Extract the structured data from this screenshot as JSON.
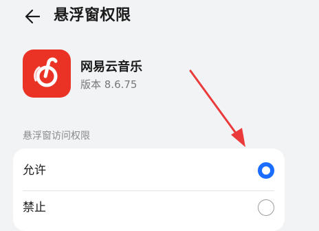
{
  "header": {
    "title": "悬浮窗权限",
    "back_icon": "arrow-left-icon"
  },
  "app": {
    "name": "网易云音乐",
    "version": "版本 8.6.75",
    "icon": "netease-cloud-music-icon",
    "icon_color": "#ea3324"
  },
  "section": {
    "label": "悬浮窗访问权限"
  },
  "options": [
    {
      "label": "允许",
      "selected": true
    },
    {
      "label": "禁止",
      "selected": false
    }
  ],
  "colors": {
    "background": "#f1f3f5",
    "accent": "#1a6dff",
    "annotation_arrow": "#ea3a3a"
  }
}
